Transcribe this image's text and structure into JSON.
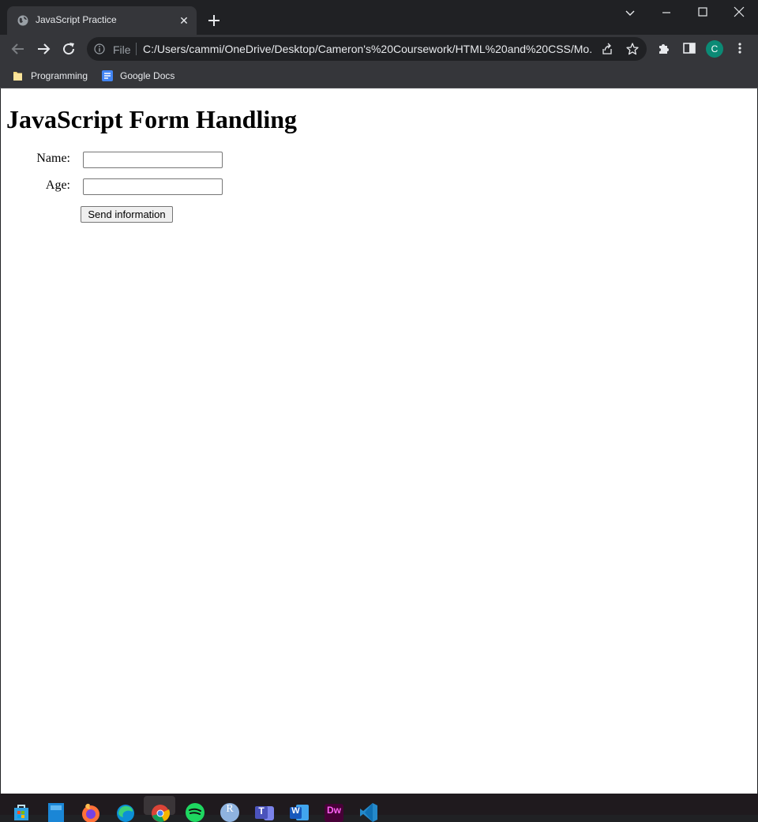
{
  "browser": {
    "tab_title": "JavaScript Practice",
    "close_glyph": "✕",
    "file_label": "File",
    "url": "C:/Users/cammi/OneDrive/Desktop/Cameron's%20Coursework/HTML%20and%20CSS/Mo...",
    "profile_initial": "C",
    "bookmarks": [
      {
        "label": "Programming",
        "icon": "folder-icon"
      },
      {
        "label": "Google Docs",
        "icon": "google-docs-icon"
      }
    ]
  },
  "page": {
    "title": "JavaScript Form Handling",
    "form": {
      "name_label": "Name:",
      "name_value": "",
      "age_label": "Age:",
      "age_value": "",
      "submit_label": "Send information"
    }
  },
  "taskbar": {
    "apps": [
      "microsoft-store-icon",
      "file-explorer-icon",
      "firefox-icon",
      "edge-icon",
      "chrome-icon",
      "spotify-icon",
      "r-icon",
      "teams-icon",
      "word-icon",
      "dreamweaver-icon",
      "vscode-icon"
    ],
    "r_letter": "R",
    "teams_letter": "T",
    "word_letter": "W",
    "dreamweaver_letters": "Dw"
  },
  "colors": {
    "chrome_dark": "#202124",
    "toolbar": "#35363a",
    "avatar": "#0b8a75",
    "page_bg": "#ffffff"
  }
}
